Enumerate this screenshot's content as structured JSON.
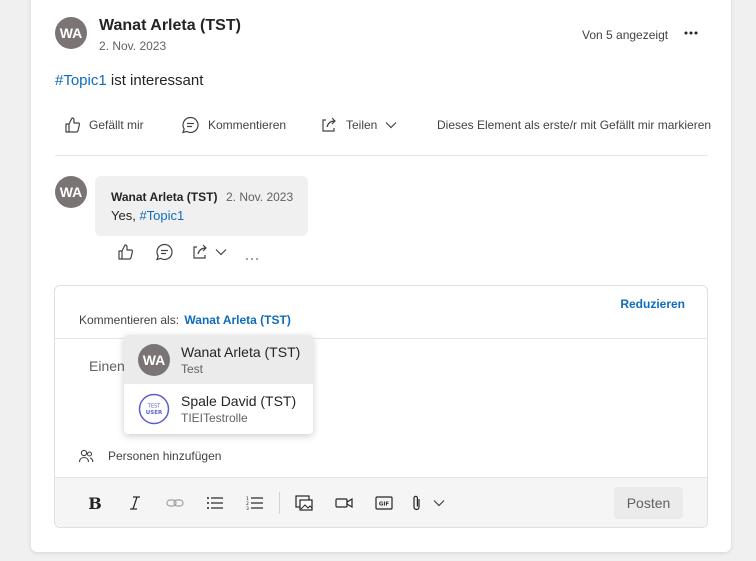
{
  "post": {
    "avatar_initials": "WA",
    "author": "Wanat Arleta (TST)",
    "date": "2. Nov. 2023",
    "seen_by": "Von 5 angezeigt",
    "hashtag": "#Topic1",
    "body_rest": " ist interessant",
    "actions": {
      "like": "Gefällt mir",
      "comment": "Kommentieren",
      "share": "Teilen",
      "mark_first": "Dieses Element als erste/r mit Gefällt mir markieren"
    }
  },
  "reply": {
    "avatar_initials": "WA",
    "author": "Wanat Arleta (TST)",
    "date": "2. Nov. 2023",
    "text_prefix": "Yes, ",
    "hashtag": "#Topic1"
  },
  "composer": {
    "collapse_label": "Reduzieren",
    "comment_as_label": "Kommentieren als:",
    "comment_as_user": "Wanat Arleta (TST)",
    "placeholder_fragment": "Einen",
    "add_people": "Personen hinzufügen",
    "post_button": "Posten"
  },
  "identity_dropdown": [
    {
      "initials": "WA",
      "name": "Wanat Arleta (TST)",
      "subtitle": "Test",
      "selected": true
    },
    {
      "badge_text_1": "TEST",
      "badge_text_2": "USER",
      "name": "Spale David (TST)",
      "subtitle": "TIEITestrolle",
      "selected": false
    }
  ],
  "colors": {
    "accent": "#0f6cbd",
    "avatar_bg": "#7a7574",
    "badge": "#5b5fc7"
  }
}
